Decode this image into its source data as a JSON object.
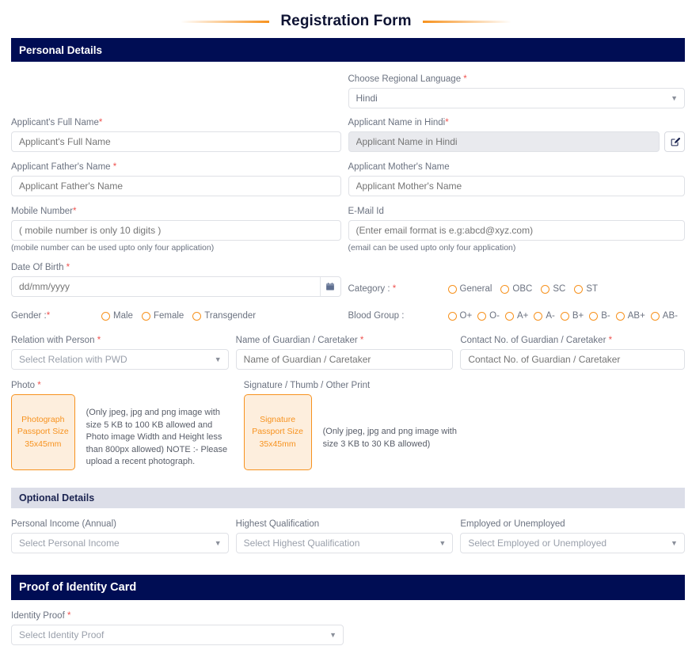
{
  "page": {
    "title": "Registration Form"
  },
  "sections": {
    "personal": "Personal Details",
    "optional": "Optional Details",
    "identity": "Proof of Identity Card"
  },
  "language": {
    "label": "Choose Regional Language",
    "required": "*",
    "value": "Hindi"
  },
  "fields": {
    "full_name": {
      "label": "Applicant's Full Name",
      "required": "*",
      "placeholder": "Applicant's Full Name"
    },
    "name_hindi": {
      "label": "Applicant Name in Hindi",
      "required": "*",
      "placeholder": "Applicant Name in Hindi"
    },
    "father_name": {
      "label": "Applicant Father's Name",
      "required": "*",
      "placeholder": "Applicant Father's Name"
    },
    "mother_name": {
      "label": "Applicant Mother's Name",
      "required": "",
      "placeholder": "Applicant Mother's Name"
    },
    "mobile": {
      "label": "Mobile Number",
      "required": "*",
      "placeholder": "( mobile number is only 10 digits )",
      "hint": "(mobile number can be used upto only four application)"
    },
    "email": {
      "label": "E-Mail Id",
      "required": "",
      "placeholder": "(Enter email format is e.g:abcd@xyz.com)",
      "hint": "(email can be used upto only four application)"
    },
    "dob": {
      "label": "Date Of Birth",
      "required": "*",
      "placeholder": "dd/mm/yyyy"
    },
    "relation": {
      "label": "Relation with Person",
      "required": "*",
      "value": "Select Relation with PWD"
    },
    "guardian_name": {
      "label": "Name of Guardian / Caretaker",
      "required": "*",
      "placeholder": "Name of Guardian / Caretaker"
    },
    "guardian_contact": {
      "label": "Contact No. of Guardian / Caretaker",
      "required": "*",
      "placeholder": "Contact No. of Guardian / Caretaker"
    },
    "income": {
      "label": "Personal Income (Annual)",
      "required": "",
      "value": "Select Personal Income"
    },
    "qualification": {
      "label": "Highest Qualification",
      "required": "",
      "value": "Select Highest Qualification"
    },
    "employment": {
      "label": "Employed or Unemployed",
      "required": "",
      "value": "Select Employed or Unemployed"
    },
    "identity_proof": {
      "label": "Identity Proof",
      "required": "*",
      "value": "Select Identity Proof"
    }
  },
  "category": {
    "label": "Category :",
    "required": "*",
    "options": [
      "General",
      "OBC",
      "SC",
      "ST"
    ]
  },
  "gender": {
    "label": "Gender :",
    "required": "*",
    "options": [
      "Male",
      "Female",
      "Transgender"
    ]
  },
  "blood_group": {
    "label": "Blood Group :",
    "required": "",
    "options": [
      "O+",
      "O-",
      "A+",
      "A-",
      "B+",
      "B-",
      "AB+",
      "AB-"
    ]
  },
  "photo": {
    "label": "Photo",
    "required": "*",
    "box_line1": "Photograph",
    "box_line2": "Passport Size",
    "box_line3": "35x45mm",
    "note": "(Only jpeg, jpg and png image with size 5 KB to 100 KB allowed and Photo image Width and Height less than 800px allowed) NOTE :- Please upload a recent photograph."
  },
  "signature": {
    "label": "Signature / Thumb / Other Print",
    "required": "",
    "box_line1": "Signature",
    "box_line2": "Passport Size",
    "box_line3": "35x45mm",
    "note": "(Only jpeg, jpg and png image with size 3 KB to 30 KB allowed)"
  },
  "icons": {
    "edit": "edit-pencil-icon",
    "calendar": "calendar-icon",
    "chevron": "chevron-down-icon"
  },
  "colors": {
    "navy": "#000d54",
    "orange": "#f7921e",
    "peach": "#fdeedd",
    "required_red": "#ef5350",
    "light_header": "#dcdee8"
  }
}
